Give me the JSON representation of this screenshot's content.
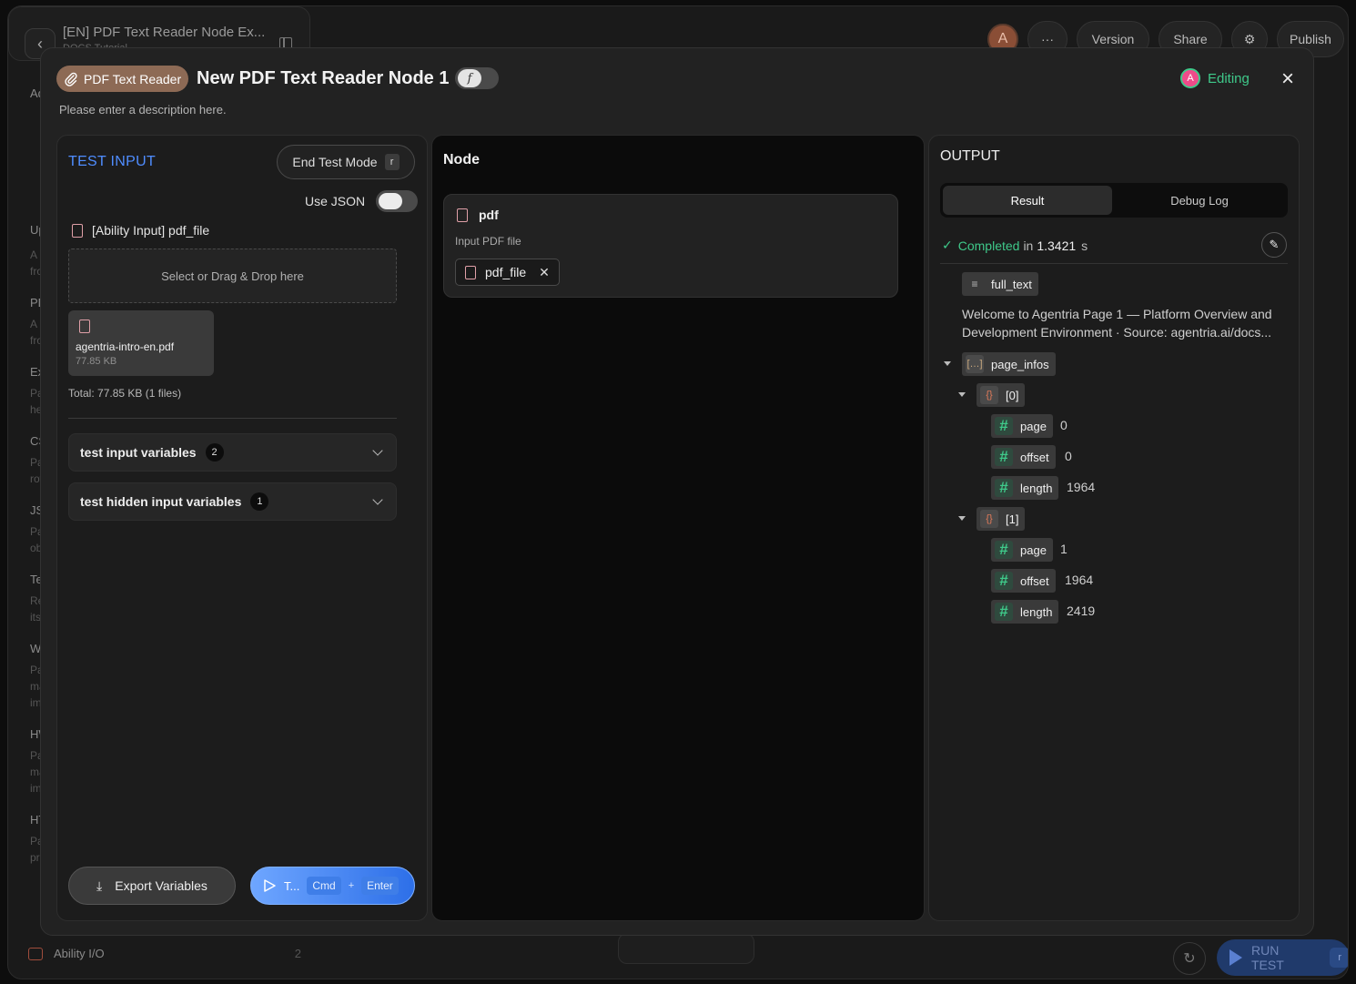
{
  "background": {
    "doc_title": "[EN] PDF Text Reader Node Ex...",
    "doc_subtitle": "DOCS Tutorial",
    "avatar_letter": "A",
    "top_buttons": {
      "more": "···",
      "version": "Version",
      "share": "Share",
      "publish": "Publish"
    },
    "sidebar_fragments": [
      "Ad",
      "Up",
      "A n",
      "fro",
      "PD",
      "A n",
      "fro",
      "Exc",
      "Par",
      "hea",
      "CS",
      "Par",
      "row",
      "JS(",
      "Par",
      "obj",
      "Tex",
      "Rea",
      "its",
      "Wo",
      "Par",
      "ma",
      "ima",
      "HW",
      "Par",
      "ma",
      "ima",
      "HT",
      "Par",
      "pre"
    ],
    "bottom_section": {
      "label": "Ability I/O",
      "count": "2"
    },
    "run_test": {
      "label": "RUN TEST",
      "shortcut": "r"
    }
  },
  "modal": {
    "chip_label": "PDF Text Reader",
    "title": "New PDF Text Reader Node 1",
    "fx_symbol": "f",
    "description": "Please enter a description here.",
    "editing": {
      "avatar": "A",
      "label": "Editing"
    },
    "close": "×"
  },
  "test_input": {
    "title": "TEST INPUT",
    "end_test_mode": {
      "label": "End Test Mode",
      "shortcut": "r"
    },
    "use_json_label": "Use JSON",
    "file_field_label": "[Ability Input] pdf_file",
    "drop_text": "Select or Drag & Drop here",
    "file": {
      "name": "agentria-intro-en.pdf",
      "size": "77.85 KB"
    },
    "total": "Total: 77.85 KB (1 files)",
    "accordions": [
      {
        "label": "test input variables",
        "count": "2"
      },
      {
        "label": "test hidden input variables",
        "count": "1"
      }
    ],
    "export_label": "Export Variables",
    "test_button": {
      "label": "T...",
      "key1": "Cmd",
      "plus": "+",
      "key2": "Enter"
    }
  },
  "node": {
    "title": "Node",
    "field": {
      "name": "pdf",
      "description": "Input PDF file",
      "tag": "pdf_file"
    }
  },
  "output": {
    "title": "OUTPUT",
    "tabs": {
      "result": "Result",
      "debug": "Debug Log"
    },
    "status": {
      "prefix": "Completed",
      "in": "in",
      "value": "1.3421",
      "unit": "s"
    },
    "full_text_key": "full_text",
    "full_text_value": "Welcome to Agentria Page 1 — Platform Overview and Development Environment · Source: agentria.ai/docs...",
    "page_infos_key": "page_infos",
    "items": [
      {
        "index": "[0]",
        "page": "0",
        "offset": "0",
        "length": "1964"
      },
      {
        "index": "[1]",
        "page": "1",
        "offset": "1964",
        "length": "2419"
      }
    ],
    "field_names": {
      "page": "page",
      "offset": "offset",
      "length": "length"
    }
  },
  "colors": {
    "accent_blue": "#4f8dff",
    "success_green": "#3fc98a",
    "chip_brown": "#8d6a55"
  }
}
